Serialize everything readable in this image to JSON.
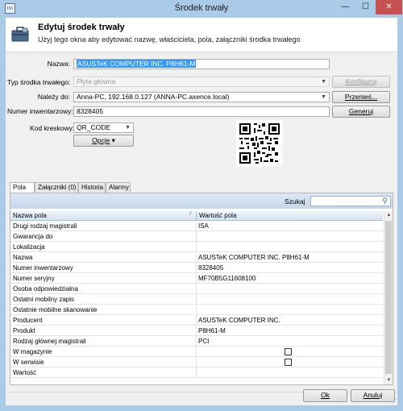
{
  "window": {
    "title": "Środek trwały"
  },
  "titlebar": {
    "minimize": "—",
    "maximize": "☐",
    "close": "✕"
  },
  "header": {
    "title": "Edytuj środek trwały",
    "subtitle": "Użyj tego okna aby edytować nazwę, właściciela, pola, załączniki środka trwałego"
  },
  "form": {
    "name_label": "Nazwa:",
    "name_value": "ASUSTeK COMPUTER INC. P8H61-M",
    "type_label": "Typ środka trwałego:",
    "type_value": "Płyta główna",
    "configure_button": "Konfiguruj",
    "belongs_label": "Należy do:",
    "belongs_value": "Anna-PC, 192.168.0.127 (ANNA-PC.axence.local)",
    "transfer_button": "Przenieś...",
    "inventory_label": "Numer inwentarzowy:",
    "inventory_value": "8328405",
    "generate_button": "Generuj",
    "barcode_label": "Kod kreskowy:",
    "barcode_value": "QR_CODE",
    "options_button": "Opcje"
  },
  "tabs": [
    {
      "label": "Pola"
    },
    {
      "label": "Załączniki (0)"
    },
    {
      "label": "Historia"
    },
    {
      "label": "Alarmy"
    }
  ],
  "search": {
    "label": "Szukaj",
    "placeholder": ""
  },
  "grid": {
    "col_name": "Nazwa pola",
    "col_value": "Wartość pola",
    "rows": [
      {
        "name": "Drugi rodzaj magistrali",
        "value": "ISA"
      },
      {
        "name": "Gwarancja do",
        "value": ""
      },
      {
        "name": "Lokalizacja",
        "value": ""
      },
      {
        "name": "Nazwa",
        "value": "ASUSTeK COMPUTER INC. P8H61-M"
      },
      {
        "name": "Numer inwentarzowy",
        "value": "8328405"
      },
      {
        "name": "Numer seryjny",
        "value": "MF70B5G11608100"
      },
      {
        "name": "Osoba odpowiedzialna",
        "value": ""
      },
      {
        "name": "Ostatni mobilny zapis",
        "value": ""
      },
      {
        "name": "Ostatnie mobilne skanowanie",
        "value": ""
      },
      {
        "name": "Producent",
        "value": "ASUSTeK COMPUTER INC."
      },
      {
        "name": "Produkt",
        "value": "P8H61-M"
      },
      {
        "name": "Rodzaj głównej magistrali",
        "value": "PCI"
      },
      {
        "name": "W magazynie",
        "value": "",
        "checkbox": true
      },
      {
        "name": "W serwisie",
        "value": "",
        "checkbox": true
      },
      {
        "name": "Wartość",
        "value": ""
      }
    ]
  },
  "footer": {
    "ok_button": "Ok",
    "cancel_button": "Anuluj"
  }
}
